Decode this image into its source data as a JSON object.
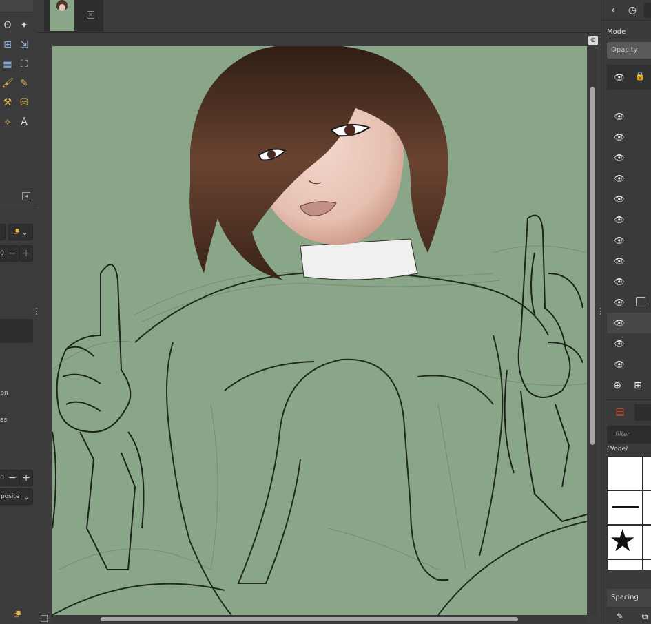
{
  "app": {
    "document_tab": {
      "close_icon": "close-square-icon"
    }
  },
  "toolbox": {
    "tools": [
      {
        "icon": "free-select-icon",
        "glyph": "ʘ"
      },
      {
        "icon": "fuzzy-select-icon",
        "glyph": "✦"
      },
      {
        "icon": "transform-icon",
        "glyph": "⊞"
      },
      {
        "icon": "align-icon",
        "glyph": "⇲"
      },
      {
        "icon": "grid-transform-icon",
        "glyph": "▦"
      },
      {
        "icon": "cage-transform-icon",
        "glyph": "⛶"
      },
      {
        "icon": "paintbrush-icon",
        "glyph": "🖌"
      },
      {
        "icon": "pencil-icon",
        "glyph": "✎"
      },
      {
        "icon": "clone-icon",
        "glyph": "⚒"
      },
      {
        "icon": "heal-icon",
        "glyph": "⛁"
      },
      {
        "icon": "path-icon",
        "glyph": "⟡"
      },
      {
        "icon": "text-icon",
        "glyph": "A"
      }
    ],
    "options": {
      "mode_button_icon": "mode-select-icon",
      "value_top": "0",
      "row_label_1": "ion",
      "row_label_2": "as",
      "value_bottom": "0",
      "composite_select": "posite"
    },
    "bottom_icon": "brush-icon"
  },
  "right_dock": {
    "tab_icons": [
      "chevron-left-icon",
      "clock-icon"
    ],
    "mode_label": "Mode",
    "opacity_label": "Opacity",
    "layers": [
      {
        "visible": true,
        "checkbox": false
      },
      {
        "visible": true,
        "checkbox": false
      },
      {
        "visible": true,
        "checkbox": false
      },
      {
        "visible": true,
        "checkbox": false
      },
      {
        "visible": true,
        "checkbox": false
      },
      {
        "visible": true,
        "checkbox": false
      },
      {
        "visible": true,
        "checkbox": false
      },
      {
        "visible": true,
        "checkbox": false
      },
      {
        "visible": true,
        "checkbox": false
      },
      {
        "visible": true,
        "checkbox": true
      },
      {
        "visible": true,
        "checkbox": false,
        "active": true
      },
      {
        "visible": true,
        "checkbox": false
      },
      {
        "visible": true,
        "checkbox": false
      }
    ],
    "new_layer_icon": "new-layer-icon",
    "new_group_icon": "new-layer-group-icon",
    "brushes_tab_icon": "brushes-tab-icon",
    "filter_placeholder": "filter",
    "brush_preset_label": "(None)",
    "spacing_label": "Spacing",
    "colors": {
      "accent": "#e5b64a",
      "canvas_bg": "#8aa688"
    }
  }
}
